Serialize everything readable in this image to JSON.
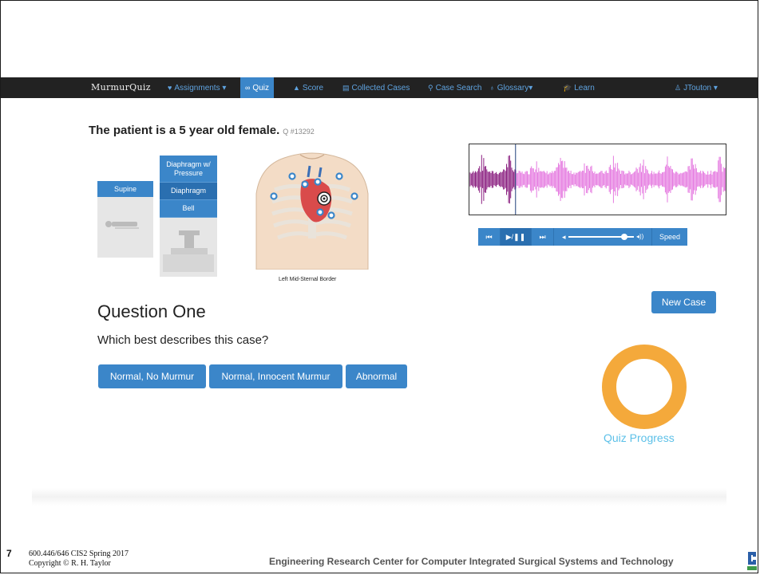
{
  "navbar": {
    "brand": "MurmurQuiz",
    "items": [
      {
        "label": "Assignments ▾",
        "icon": "heartbeat-icon"
      },
      {
        "label": "Quiz",
        "icon": "glasses-icon",
        "active": true
      },
      {
        "label": "Score",
        "icon": "area-chart-icon"
      },
      {
        "label": "Collected Cases",
        "icon": "list-icon"
      },
      {
        "label": "Case Search",
        "icon": "search-icon"
      },
      {
        "label": "Glossary▾",
        "icon": "stethoscope-icon"
      },
      {
        "label": "Learn",
        "icon": "graduation-cap-icon"
      },
      {
        "label": "JTouton ▾",
        "icon": "user-icon"
      }
    ]
  },
  "patient": {
    "description": "The patient is a 5 year old female.",
    "question_id": "Q #13292"
  },
  "position": {
    "label": "Supine"
  },
  "stethoscope": {
    "options": [
      "Diaphragm w/ Pressure",
      "Diaphragm",
      "Bell"
    ],
    "selected": "Diaphragm"
  },
  "chest": {
    "location_label": "Left Mid-Sternal Border"
  },
  "player": {
    "speed_label": "Speed",
    "volume": 0.85,
    "playhead": 0.18
  },
  "new_case_label": "New Case",
  "question": {
    "title": "Question One",
    "prompt": "Which best describes this case?",
    "answers": [
      "Normal, No Murmur",
      "Normal, Innocent Murmur",
      "Abnormal"
    ]
  },
  "progress": {
    "label": "Quiz Progress",
    "color": "#f4a93b"
  },
  "footer": {
    "page_number": "7",
    "course_line1": "600.446/646 CIS2 Spring 2017",
    "course_line2": "Copyright © R. H. Taylor",
    "center": "Engineering Research Center for Computer Integrated Surgical Systems and Technology"
  }
}
